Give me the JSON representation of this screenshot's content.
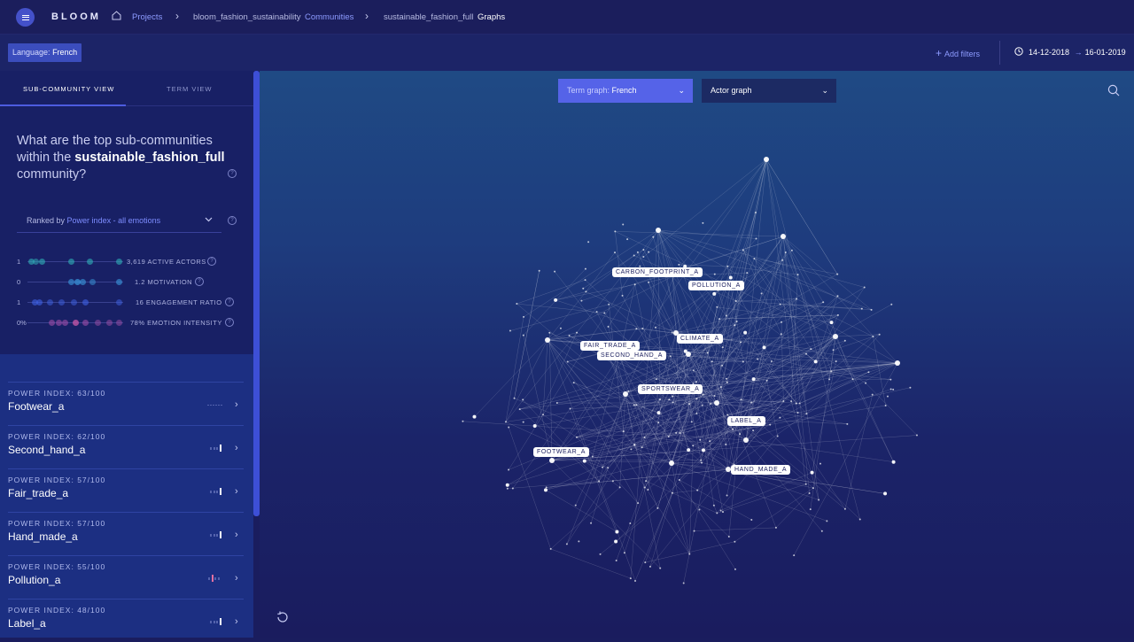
{
  "header": {
    "logo": "BLOOM",
    "breadcrumbs": {
      "projects": "Projects",
      "project": "bloom_fashion_sustainability",
      "communities": "Communities",
      "community": "sustainable_fashion_full",
      "current": "Graphs"
    }
  },
  "filters": {
    "language_label": "Language:",
    "language_value": "French",
    "add_filters": "Add filters",
    "date_from": "14-12-2018",
    "date_to": "16-01-2019"
  },
  "sidebar": {
    "tabs": [
      "SUB-COMMUNITY VIEW",
      "TERM VIEW"
    ],
    "question_pre": "What are the top sub-communities within the",
    "question_bold": "sustainable_fashion_full",
    "question_post": "community?",
    "ranked_pre": "Ranked by",
    "ranked_value": "Power index - all emotions",
    "metrics": [
      {
        "min": "1",
        "label": "3,619 ACTIVE ACTORS",
        "color": "#2fb3b8"
      },
      {
        "min": "0",
        "label": "1.2 MOTIVATION",
        "color": "#3a9be0"
      },
      {
        "min": "1",
        "label": "16 ENGAGEMENT RATIO",
        "color": "#3f63e6"
      },
      {
        "min": "0%",
        "label": "78% EMOTION INTENSITY",
        "color": "#a14fa8"
      }
    ],
    "items": [
      {
        "pi_label": "POWER INDEX:",
        "pi_value": "63/100",
        "name": "Footwear_a"
      },
      {
        "pi_label": "POWER INDEX:",
        "pi_value": "62/100",
        "name": "Second_hand_a"
      },
      {
        "pi_label": "POWER INDEX:",
        "pi_value": "57/100",
        "name": "Fair_trade_a"
      },
      {
        "pi_label": "POWER INDEX:",
        "pi_value": "57/100",
        "name": "Hand_made_a"
      },
      {
        "pi_label": "POWER INDEX:",
        "pi_value": "55/100",
        "name": "Pollution_a"
      },
      {
        "pi_label": "POWER INDEX:",
        "pi_value": "48/100",
        "name": "Label_a"
      }
    ]
  },
  "graph": {
    "term_graph_label": "Term graph:",
    "term_graph_value": "French",
    "actor_graph": "Actor graph",
    "labels": [
      "CARBON_FOOTPRINT_A",
      "POLLUTION_A",
      "CLIMATE_A",
      "FAIR_TRADE_A",
      "SECOND_HAND_A",
      "SPORTSWEAR_A",
      "LABEL_A",
      "FOOTWEAR_A",
      "HAND_MADE_A"
    ]
  },
  "icons": {
    "menu": "menu-icon",
    "home": "home-icon",
    "plus": "plus-icon",
    "clock": "clock-icon",
    "search": "search-icon",
    "refresh": "refresh-icon",
    "info": "info-icon"
  }
}
